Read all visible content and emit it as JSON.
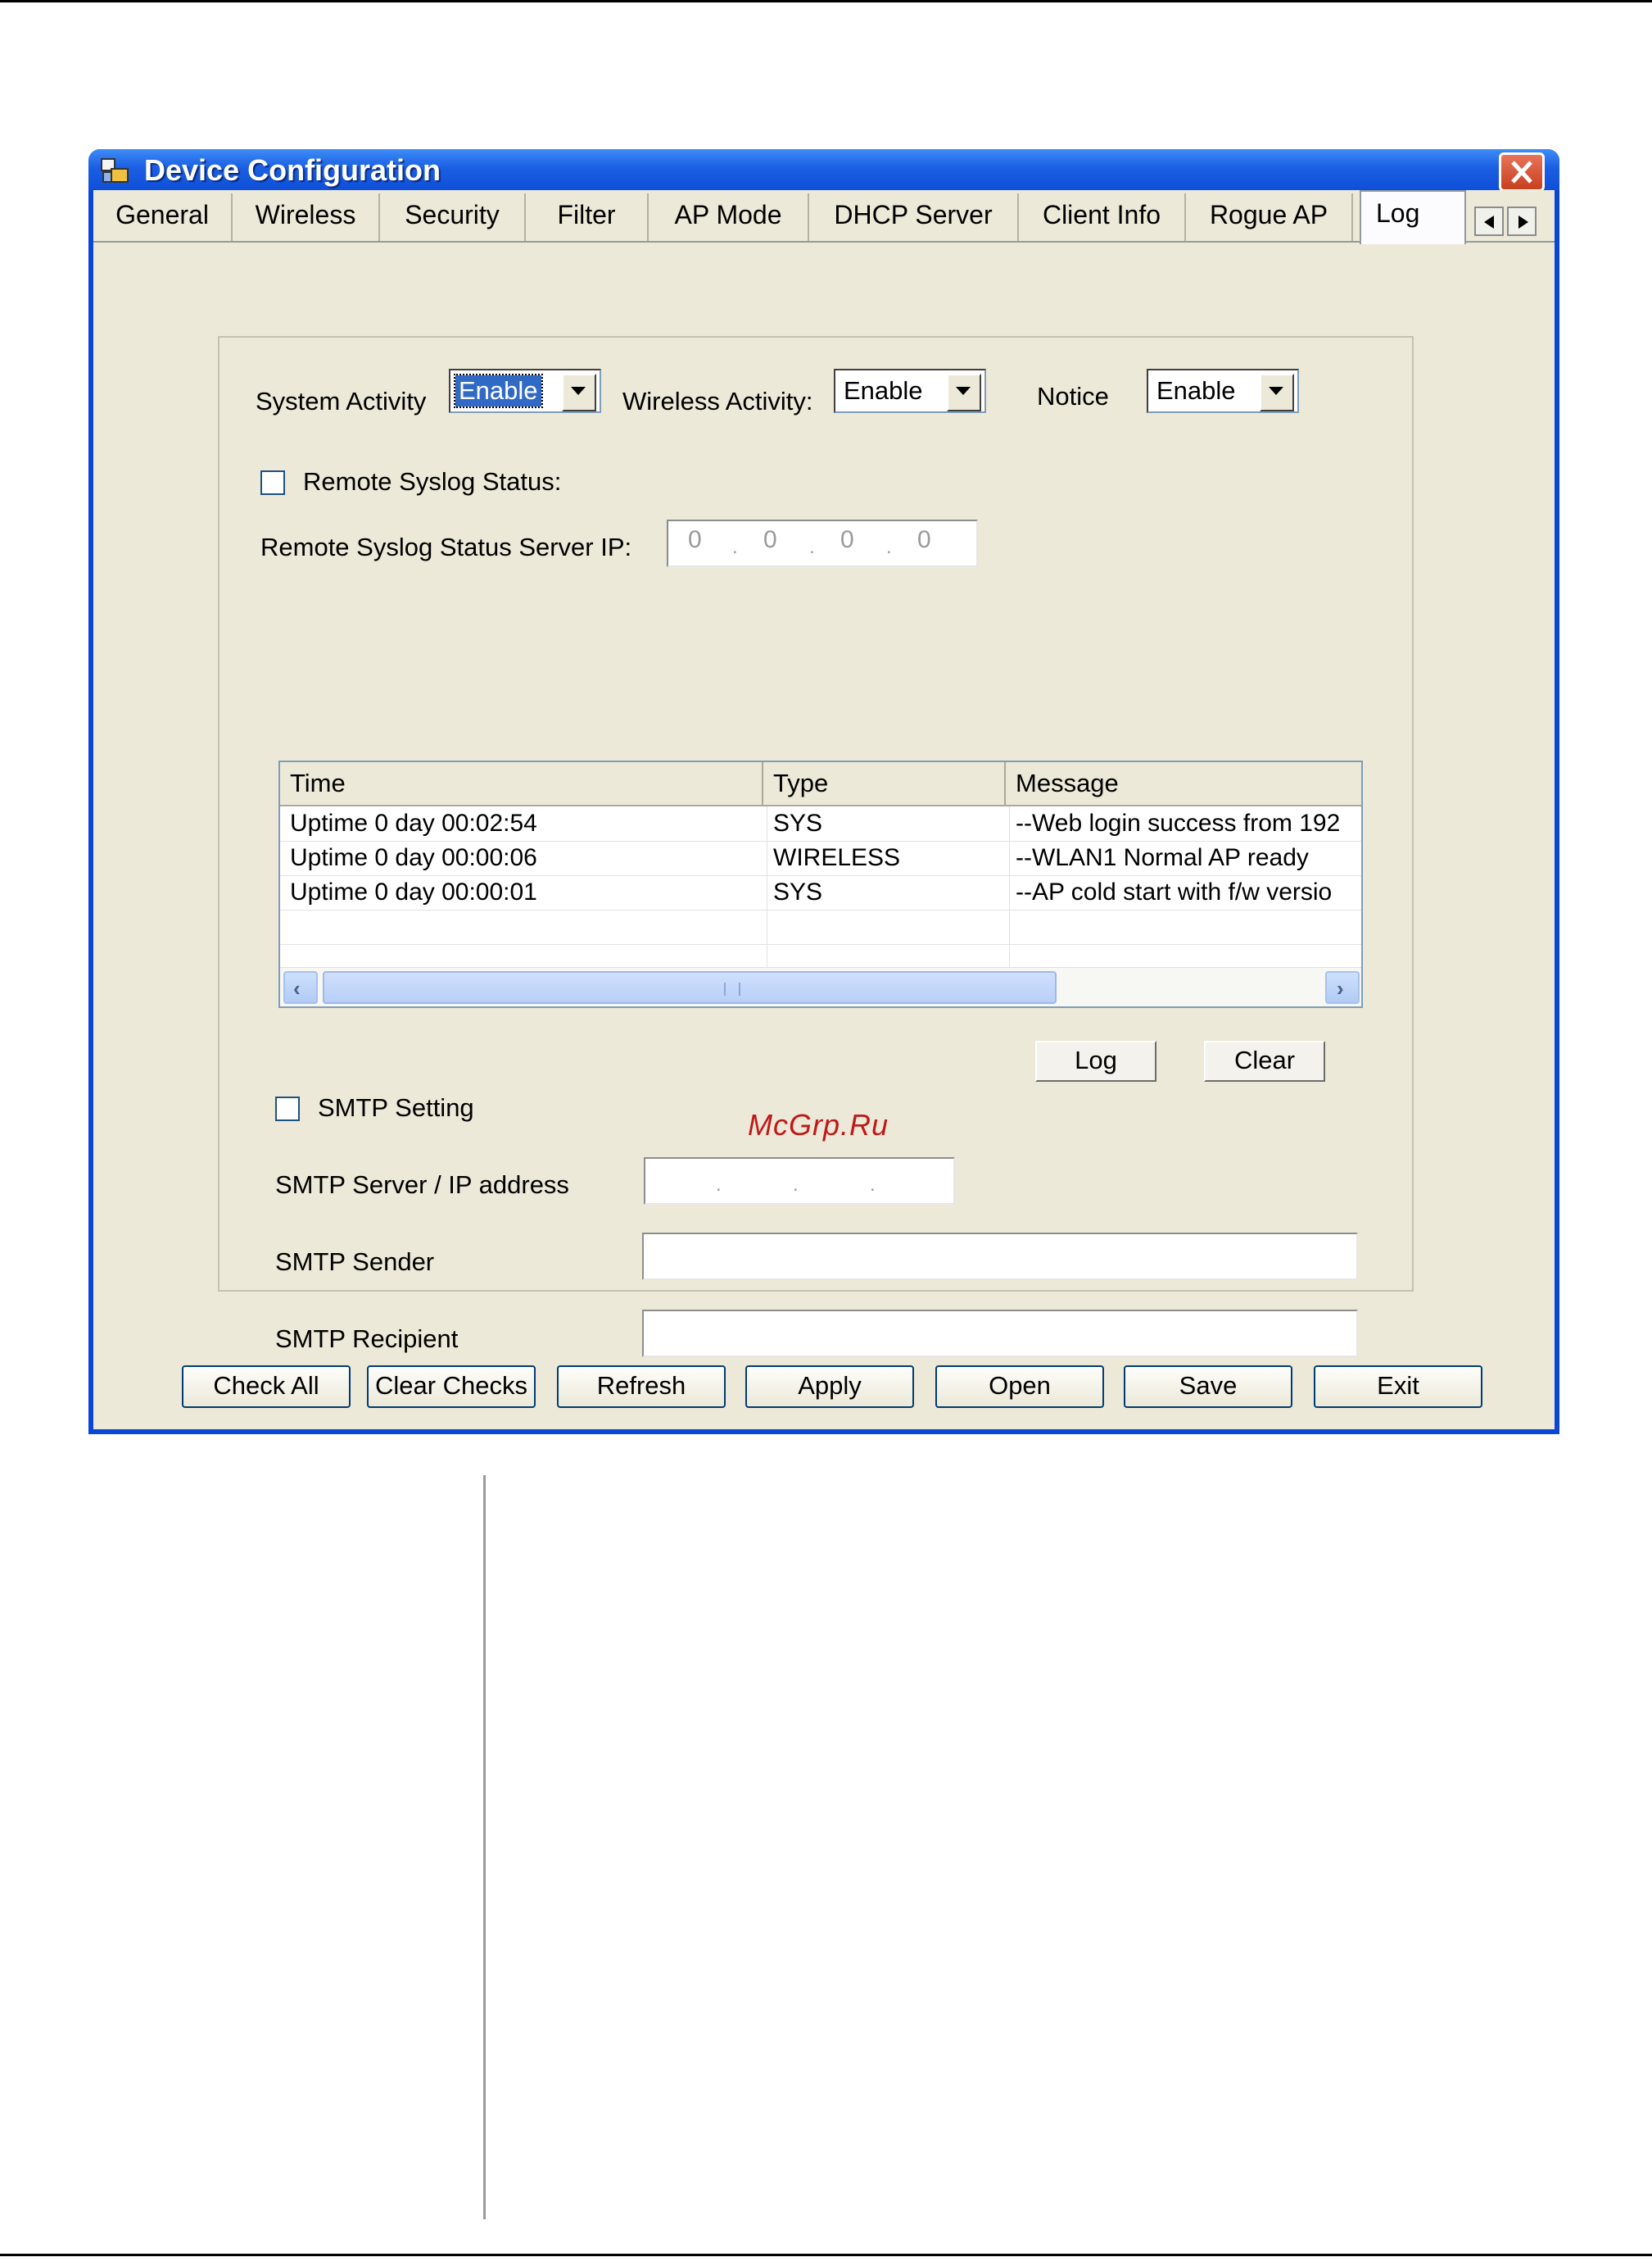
{
  "window": {
    "title": "Device Configuration"
  },
  "tabs": [
    {
      "label": "General"
    },
    {
      "label": "Wireless"
    },
    {
      "label": "Security"
    },
    {
      "label": "Filter"
    },
    {
      "label": "AP Mode"
    },
    {
      "label": "DHCP Server"
    },
    {
      "label": "Client Info"
    },
    {
      "label": "Rogue AP"
    },
    {
      "label": "Log",
      "active": true
    }
  ],
  "log_settings": {
    "system_activity_label": "System Activity",
    "system_activity_value": "Enable",
    "wireless_activity_label": "Wireless Activity:",
    "wireless_activity_value": "Enable",
    "notice_label": "Notice",
    "notice_value": "Enable",
    "remote_syslog_label": "Remote Syslog Status:",
    "remote_syslog_checked": false,
    "remote_server_ip_label": "Remote Syslog Status Server IP:",
    "remote_server_ip": [
      "0",
      "0",
      "0",
      "0"
    ]
  },
  "log_table": {
    "columns": [
      "Time",
      "Type",
      "Message"
    ],
    "rows": [
      {
        "time": "Uptime 0 day 00:02:54",
        "type": "SYS",
        "message": "--Web login success from 192"
      },
      {
        "time": "Uptime 0 day 00:00:06",
        "type": "WIRELESS",
        "message": "--WLAN1 Normal AP ready"
      },
      {
        "time": "Uptime 0 day 00:00:01",
        "type": "SYS",
        "message": "--AP cold start with f/w versio"
      }
    ]
  },
  "log_buttons": {
    "log": "Log",
    "clear": "Clear"
  },
  "smtp": {
    "setting_label": "SMTP Setting",
    "setting_checked": false,
    "server_label": "SMTP Server / IP address",
    "sender_label": "SMTP Sender",
    "sender_value": "",
    "recipient_label": "SMTP Recipient",
    "recipient_value": ""
  },
  "footer_buttons": {
    "check_all": "Check All",
    "clear_checks": "Clear Checks",
    "refresh": "Refresh",
    "apply": "Apply",
    "open": "Open",
    "save": "Save",
    "exit": "Exit"
  },
  "watermark": "McGrp.Ru",
  "colors": {
    "titlebar": "#1b5fe3",
    "client_bg": "#ece9d8",
    "selection": "#316ac5",
    "watermark": "#c01818"
  }
}
